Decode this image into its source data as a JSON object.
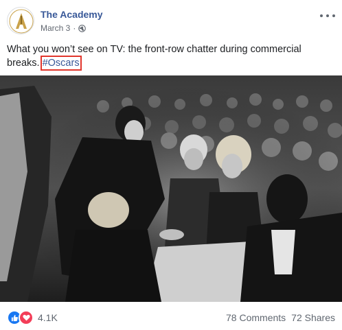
{
  "post": {
    "page_name": "The Academy",
    "date": "March 3",
    "separator": "·",
    "text_before": "What you won’t see on TV: the front-row chatter during commercial breaks.",
    "hashtag": "#Oscars",
    "privacy_icon": "globe-icon",
    "menu_icon": "more-options-icon"
  },
  "footer": {
    "reaction_icons": [
      "like-icon",
      "love-icon"
    ],
    "reaction_count": "4.1K",
    "comments": "78 Comments",
    "shares": "72 Shares"
  },
  "colors": {
    "link": "#385898",
    "hashtag_highlight": "#e1352b",
    "like": "#1877f2",
    "love": "#f33e58",
    "logo_gold": "#c9a24a"
  }
}
